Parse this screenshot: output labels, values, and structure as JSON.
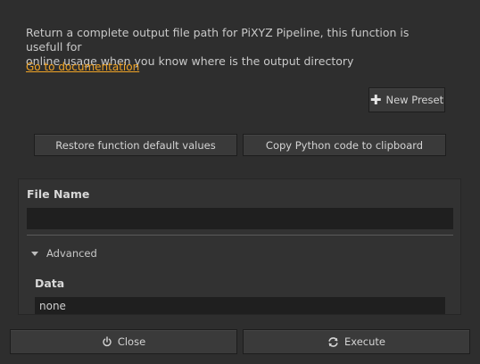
{
  "description": {
    "line1": "Return a complete output file path for PiXYZ Pipeline, this function is usefull for",
    "line2": "online usage when you know where is the output directory"
  },
  "documentation_link": "Go to documentation",
  "toolbar": {
    "new_preset_label": "New Preset",
    "restore_label": "Restore function default values",
    "copy_python_label": "Copy Python code to clipboard"
  },
  "params": {
    "file_name_label": "File Name",
    "file_name_value": "",
    "advanced_label": "Advanced",
    "data_label": "Data",
    "data_value": "none"
  },
  "footer": {
    "close_label": "Close",
    "execute_label": "Execute"
  },
  "colors": {
    "background": "#2e2e2e",
    "link": "#f0a426",
    "input_bg": "#1f1f1f"
  },
  "icons": {
    "new_preset": "plus-icon",
    "advanced": "triangle-down-icon",
    "close": "power-icon",
    "execute": "refresh-icon"
  }
}
